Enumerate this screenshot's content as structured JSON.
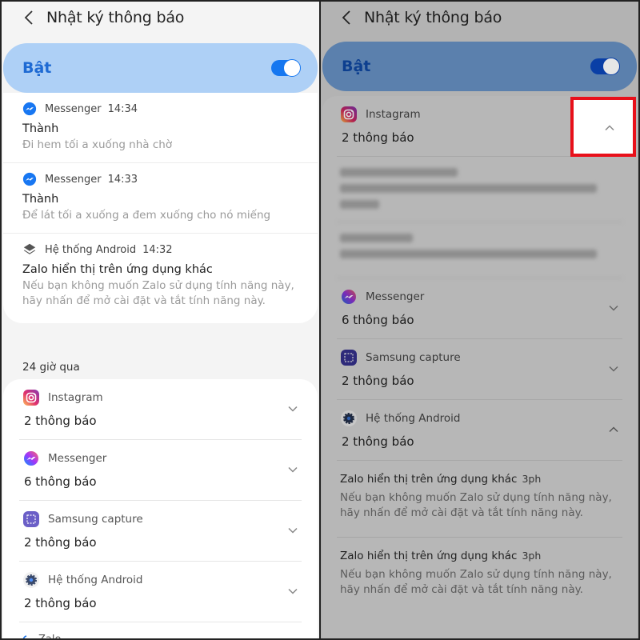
{
  "left_panel": {
    "header": {
      "back_icon": "chevron-left-icon",
      "title": "Nhật ký thông báo"
    },
    "master_toggle": {
      "label": "Bật",
      "state": "on",
      "accent": "#1677f0"
    },
    "recent": [
      {
        "app": "Messenger",
        "icon": "messenger-icon",
        "time": "14:34",
        "title": "Thành",
        "body": "Đi hem tối a xuống nhà chờ"
      },
      {
        "app": "Messenger",
        "icon": "messenger-icon",
        "time": "14:33",
        "title": "Thành",
        "body": "Để lát tối a xuống a đem xuống cho nó miếng"
      },
      {
        "app": "Hệ thống Android",
        "icon": "layers-icon",
        "time": "14:32",
        "title": "Zalo hiển thị trên ứng dụng khác",
        "body": "Nếu bạn không muốn Zalo sử dụng tính năng này, hãy nhấn để mở cài đặt và tắt tính năng này."
      }
    ],
    "section_label": "24 giờ qua",
    "groups": [
      {
        "app": "Instagram",
        "icon": "instagram-icon",
        "count": "2 thông báo",
        "expanded": false
      },
      {
        "app": "Messenger",
        "icon": "messenger-icon",
        "count": "6 thông báo",
        "expanded": false
      },
      {
        "app": "Samsung capture",
        "icon": "samsung-capture-icon",
        "count": "2 thông báo",
        "expanded": false
      },
      {
        "app": "Hệ thống Android",
        "icon": "android-system-gear-icon",
        "count": "2 thông báo",
        "expanded": false
      }
    ],
    "partial_item": {
      "app": "Zalo",
      "icon": "zalo-icon"
    }
  },
  "right_panel": {
    "header": {
      "back_icon": "chevron-left-icon",
      "title": "Nhật ký thông báo"
    },
    "master_toggle": {
      "label": "Bật",
      "state": "on"
    },
    "groups": [
      {
        "app": "Instagram",
        "icon": "instagram-icon",
        "count": "2 thông báo",
        "expanded": true
      },
      {
        "app": "Messenger",
        "icon": "messenger-icon",
        "count": "6 thông báo",
        "expanded": false
      },
      {
        "app": "Samsung capture",
        "icon": "samsung-capture-icon",
        "count": "2 thông báo",
        "expanded": false
      },
      {
        "app": "Hệ thống Android",
        "icon": "android-system-gear-icon",
        "count": "2 thông báo",
        "expanded": true
      }
    ],
    "android_sub_items": [
      {
        "title": "Zalo hiển thị trên ứng dụng khác",
        "time": "3ph",
        "body": "Nếu bạn không muốn Zalo sử dụng tính năng này, hãy nhấn để mở cài đặt và tắt tính năng này."
      },
      {
        "title": "Zalo hiển thị trên ứng dụng khác",
        "time": "3ph",
        "body": "Nếu bạn không muốn Zalo sử dụng tính năng này, hãy nhấn để mở cài đặt và tắt tính năng này."
      }
    ],
    "highlight": {
      "target": "instagram-collapse-chevron",
      "color": "#e8101a"
    }
  }
}
